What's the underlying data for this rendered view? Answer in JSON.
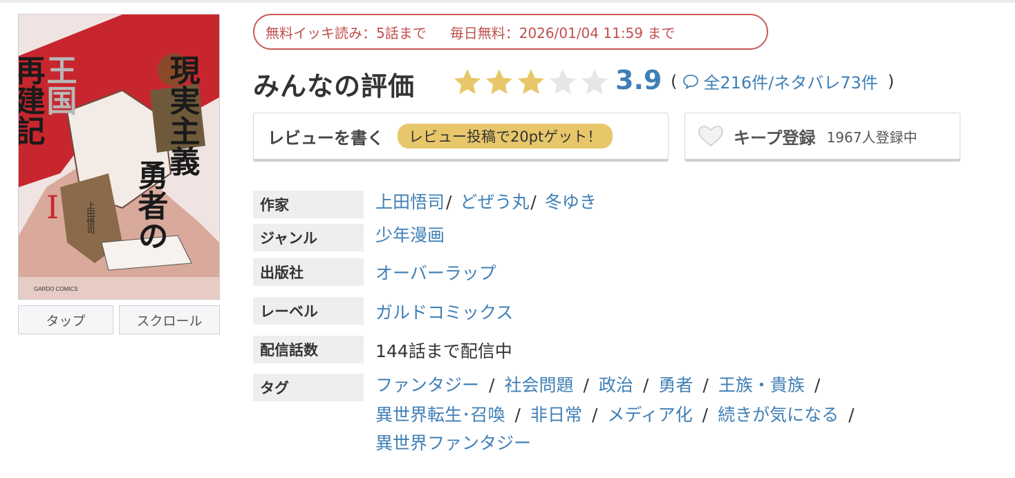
{
  "cover": {
    "title_lines": [
      "現実主義",
      "勇者の",
      "王国",
      "再建記"
    ],
    "volume": "I",
    "author_small": "上田悟司",
    "publisher_logo": "GARDO COMICS",
    "buttons": {
      "tap": "タップ",
      "scroll": "スクロール"
    }
  },
  "free_badge": {
    "ikki": "無料イッキ読み：5話まで",
    "daily": "毎日無料：2026/01/04 11:59 まで"
  },
  "rating": {
    "title": "みんなの評価",
    "score": "3.9",
    "score_value": 3.9,
    "stars_max": 5,
    "paren_open": "(",
    "paren_close": ")",
    "count_text": "全216件/ネタバレ73件"
  },
  "actions": {
    "write_review": "レビューを書く",
    "review_bonus": "レビュー投稿で20ptゲット！",
    "keep": "キープ登録",
    "keep_count": "1967人登録中"
  },
  "info": {
    "author_label": "作家",
    "authors": [
      "上田悟司",
      "どぜう丸",
      "冬ゆき"
    ],
    "author_sep": "/",
    "genre_label": "ジャンル",
    "genre": "少年漫画",
    "publisher_label": "出版社",
    "publisher": "オーバーラップ",
    "label_label": "レーベル",
    "label": "ガルドコミックス",
    "episodes_label": "配信話数",
    "episodes": "144話まで配信中",
    "tags_label": "タグ",
    "tags": [
      "ファンタジー",
      "社会問題",
      "政治",
      "勇者",
      "王族・貴族",
      "異世界転生･召喚",
      "非日常",
      "メディア化",
      "続きが気になる",
      "異世界ファンタジー"
    ],
    "tag_sep": "/"
  },
  "colors": {
    "link": "#3f7fb6",
    "badge_border": "#c75a5a",
    "star_filled": "#e8c76a",
    "star_empty": "#e6e6e6",
    "pill": "#e8c76a"
  },
  "icons": [
    "star-icon",
    "speech-bubble-icon",
    "heart-icon"
  ]
}
